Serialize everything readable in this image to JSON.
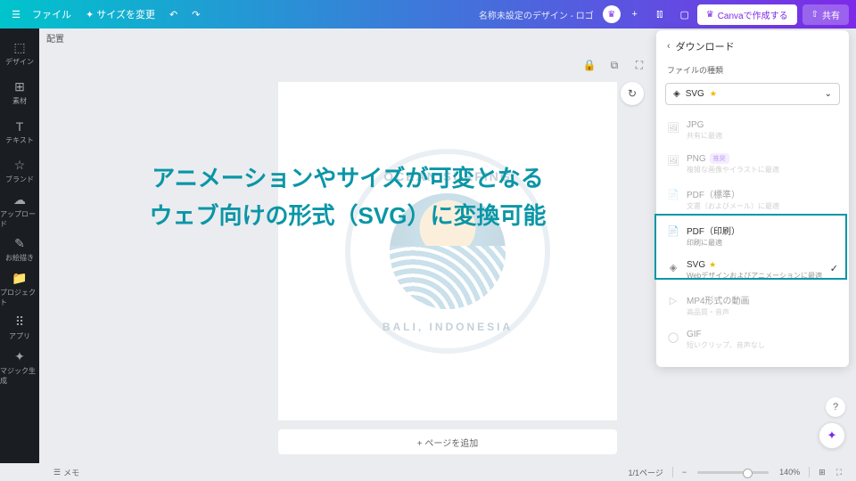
{
  "topbar": {
    "file": "ファイル",
    "resize": "サイズを変更",
    "design_title": "名称未設定のデザイン - ロゴ",
    "create": "Canvaで作成する",
    "share": "共有"
  },
  "leftnav": [
    {
      "icon": "⬚",
      "label": "デザイン"
    },
    {
      "icon": "⊞",
      "label": "素材"
    },
    {
      "icon": "T",
      "label": "テキスト"
    },
    {
      "icon": "☆",
      "label": "ブランド"
    },
    {
      "icon": "☁",
      "label": "アップロード"
    },
    {
      "icon": "✎",
      "label": "お絵描き"
    },
    {
      "icon": "📁",
      "label": "プロジェクト"
    },
    {
      "icon": "⠿",
      "label": "アプリ"
    },
    {
      "icon": "✦",
      "label": "マジック生成"
    }
  ],
  "subbar": {
    "position": "配置"
  },
  "logo": {
    "top": "OCEAN SURFING",
    "bottom": "BALI, INDONESIA"
  },
  "overlay": {
    "line1": "アニメーションやサイズが可変となる",
    "line2": "ウェブ向けの形式（SVG）に変換可能"
  },
  "add_page": "+ ページを追加",
  "download": {
    "title": "ダウンロード",
    "filetype_label": "ファイルの種類",
    "selected": "SVG",
    "formats": [
      {
        "name": "JPG",
        "desc": "共有に最適",
        "icon": "🖼",
        "disabled": true
      },
      {
        "name": "PNG",
        "desc": "複雑な画像やイラストに最適",
        "icon": "🖼",
        "badge": "推奨",
        "disabled": true
      },
      {
        "name": "PDF（標準）",
        "desc": "文書（およびメール）に最適",
        "icon": "📄",
        "disabled": true
      },
      {
        "name": "PDF（印刷）",
        "desc": "印刷に最適",
        "icon": "📄",
        "boxed": true
      },
      {
        "name": "SVG",
        "desc": "Webデザインおよびアニメーションに最適",
        "icon": "◈",
        "star": true,
        "checked": true,
        "boxed": true
      },
      {
        "name": "MP4形式の動画",
        "desc": "高品質・音声",
        "icon": "▷",
        "disabled": true,
        "boxed": true
      },
      {
        "name": "GIF",
        "desc": "短いクリップ、音声なし",
        "icon": "◯",
        "disabled": true
      }
    ]
  },
  "bottombar": {
    "memo": "メモ",
    "pages": "1/1ページ",
    "zoom": "140%"
  }
}
